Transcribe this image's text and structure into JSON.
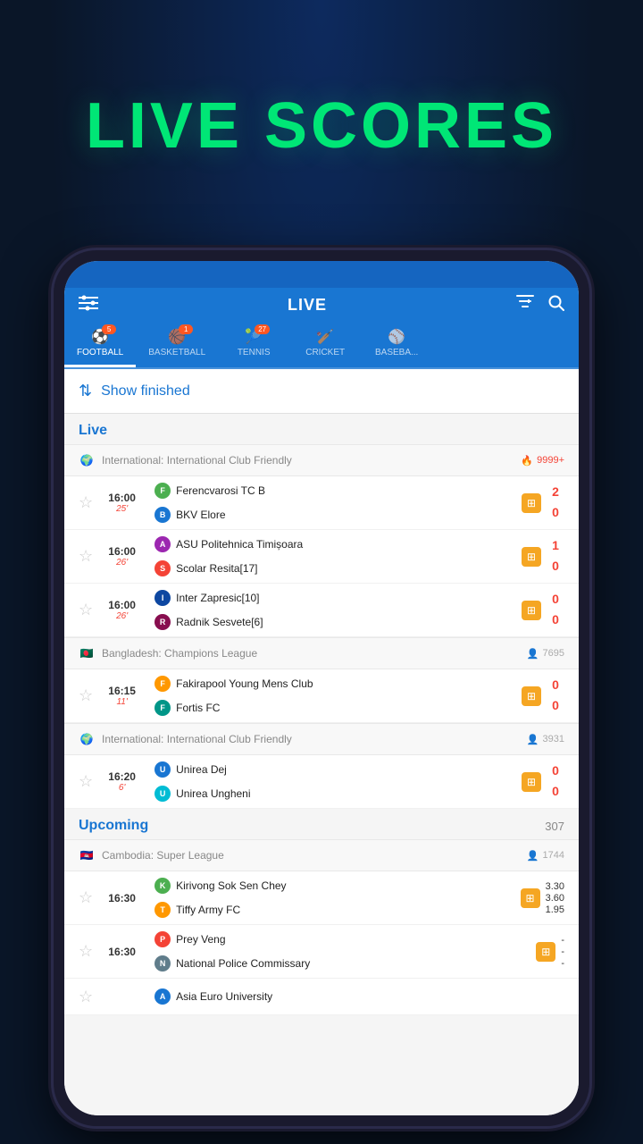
{
  "title": "LIVE SCORES",
  "app": {
    "header_title": "LIVE",
    "filter_icon": "⚙",
    "search_icon": "🔍"
  },
  "tabs": [
    {
      "id": "football",
      "label": "FOOTBALL",
      "icon": "⚽",
      "count": 5,
      "active": true
    },
    {
      "id": "basketball",
      "label": "BASKETBALL",
      "icon": "🏀",
      "count": 1,
      "active": false
    },
    {
      "id": "tennis",
      "label": "TENNIS",
      "icon": "🎾",
      "count": 27,
      "active": false
    },
    {
      "id": "cricket",
      "label": "CRICKET",
      "icon": "🏏",
      "count": null,
      "active": false
    },
    {
      "id": "baseball",
      "label": "BASEBA...",
      "icon": "⚾",
      "count": null,
      "active": false
    }
  ],
  "show_finished": "Show finished",
  "live_section": {
    "label": "Live",
    "leagues": [
      {
        "id": "intl-club-friendly-1",
        "flag": "🌍",
        "name": "International: International Club Friendly",
        "viewers": "9999+",
        "viewers_icon": "🔥",
        "matches": [
          {
            "time": "16:00",
            "live_min": "25'",
            "team1": "Ferencvarosi TC B",
            "team2": "BKV Elore",
            "score1": "2",
            "score2": "0",
            "logo1": "F",
            "logo2": "B",
            "logo1_color": "logo-green",
            "logo2_color": "logo-blue"
          },
          {
            "time": "16:00",
            "live_min": "26'",
            "team1": "ASU Politehnica Timișoara",
            "team2": "Scolar Resita[17]",
            "score1": "1",
            "score2": "0",
            "logo1": "A",
            "logo2": "S",
            "logo1_color": "logo-purple",
            "logo2_color": "logo-red"
          },
          {
            "time": "16:00",
            "live_min": "26'",
            "team1": "Inter Zapresic[10]",
            "team2": "Radnik Sesvete[6]",
            "score1": "0",
            "score2": "0",
            "logo1": "I",
            "logo2": "R",
            "logo1_color": "logo-darkblue",
            "logo2_color": "logo-maroon"
          }
        ]
      },
      {
        "id": "bangladesh-champions",
        "flag": "🇧🇩",
        "name": "Bangladesh: Champions League",
        "viewers": "7695",
        "viewers_icon": "👤",
        "matches": [
          {
            "time": "16:15",
            "live_min": "11'",
            "team1": "Fakirapool Young Mens Club",
            "team2": "Fortis FC",
            "score1": "0",
            "score2": "0",
            "logo1": "F",
            "logo2": "F",
            "logo1_color": "logo-orange",
            "logo2_color": "logo-teal"
          }
        ]
      },
      {
        "id": "intl-club-friendly-2",
        "flag": "🌍",
        "name": "International: International Club Friendly",
        "viewers": "3931",
        "viewers_icon": "👤",
        "matches": [
          {
            "time": "16:20",
            "live_min": "6'",
            "team1": "Unirea Dej",
            "team2": "Unirea Ungheni",
            "score1": "0",
            "score2": "0",
            "logo1": "U",
            "logo2": "U",
            "logo1_color": "logo-blue",
            "logo2_color": "logo-cyan"
          }
        ]
      }
    ]
  },
  "upcoming_section": {
    "label": "Upcoming",
    "count": "307",
    "leagues": [
      {
        "id": "cambodia-super",
        "flag": "🇰🇭",
        "name": "Cambodia: Super League",
        "viewers": "1744",
        "viewers_icon": "👤",
        "matches": [
          {
            "time": "16:30",
            "team1": "Kirivong Sok Sen Chey",
            "team2": "Tiffy Army FC",
            "odds1": "3.30",
            "odds_draw": "3.60",
            "odds2": "1.95",
            "logo1": "K",
            "logo2": "T",
            "logo1_color": "logo-green",
            "logo2_color": "logo-orange"
          },
          {
            "time": "16:30",
            "team1": "Prey Veng",
            "team2": "National Police Commissary",
            "odds1": "-",
            "odds_draw": "-",
            "odds2": "-",
            "logo1": "P",
            "logo2": "N",
            "logo1_color": "logo-red",
            "logo2_color": "logo-gray"
          }
        ]
      }
    ],
    "partial_team": "Asia Euro University"
  }
}
